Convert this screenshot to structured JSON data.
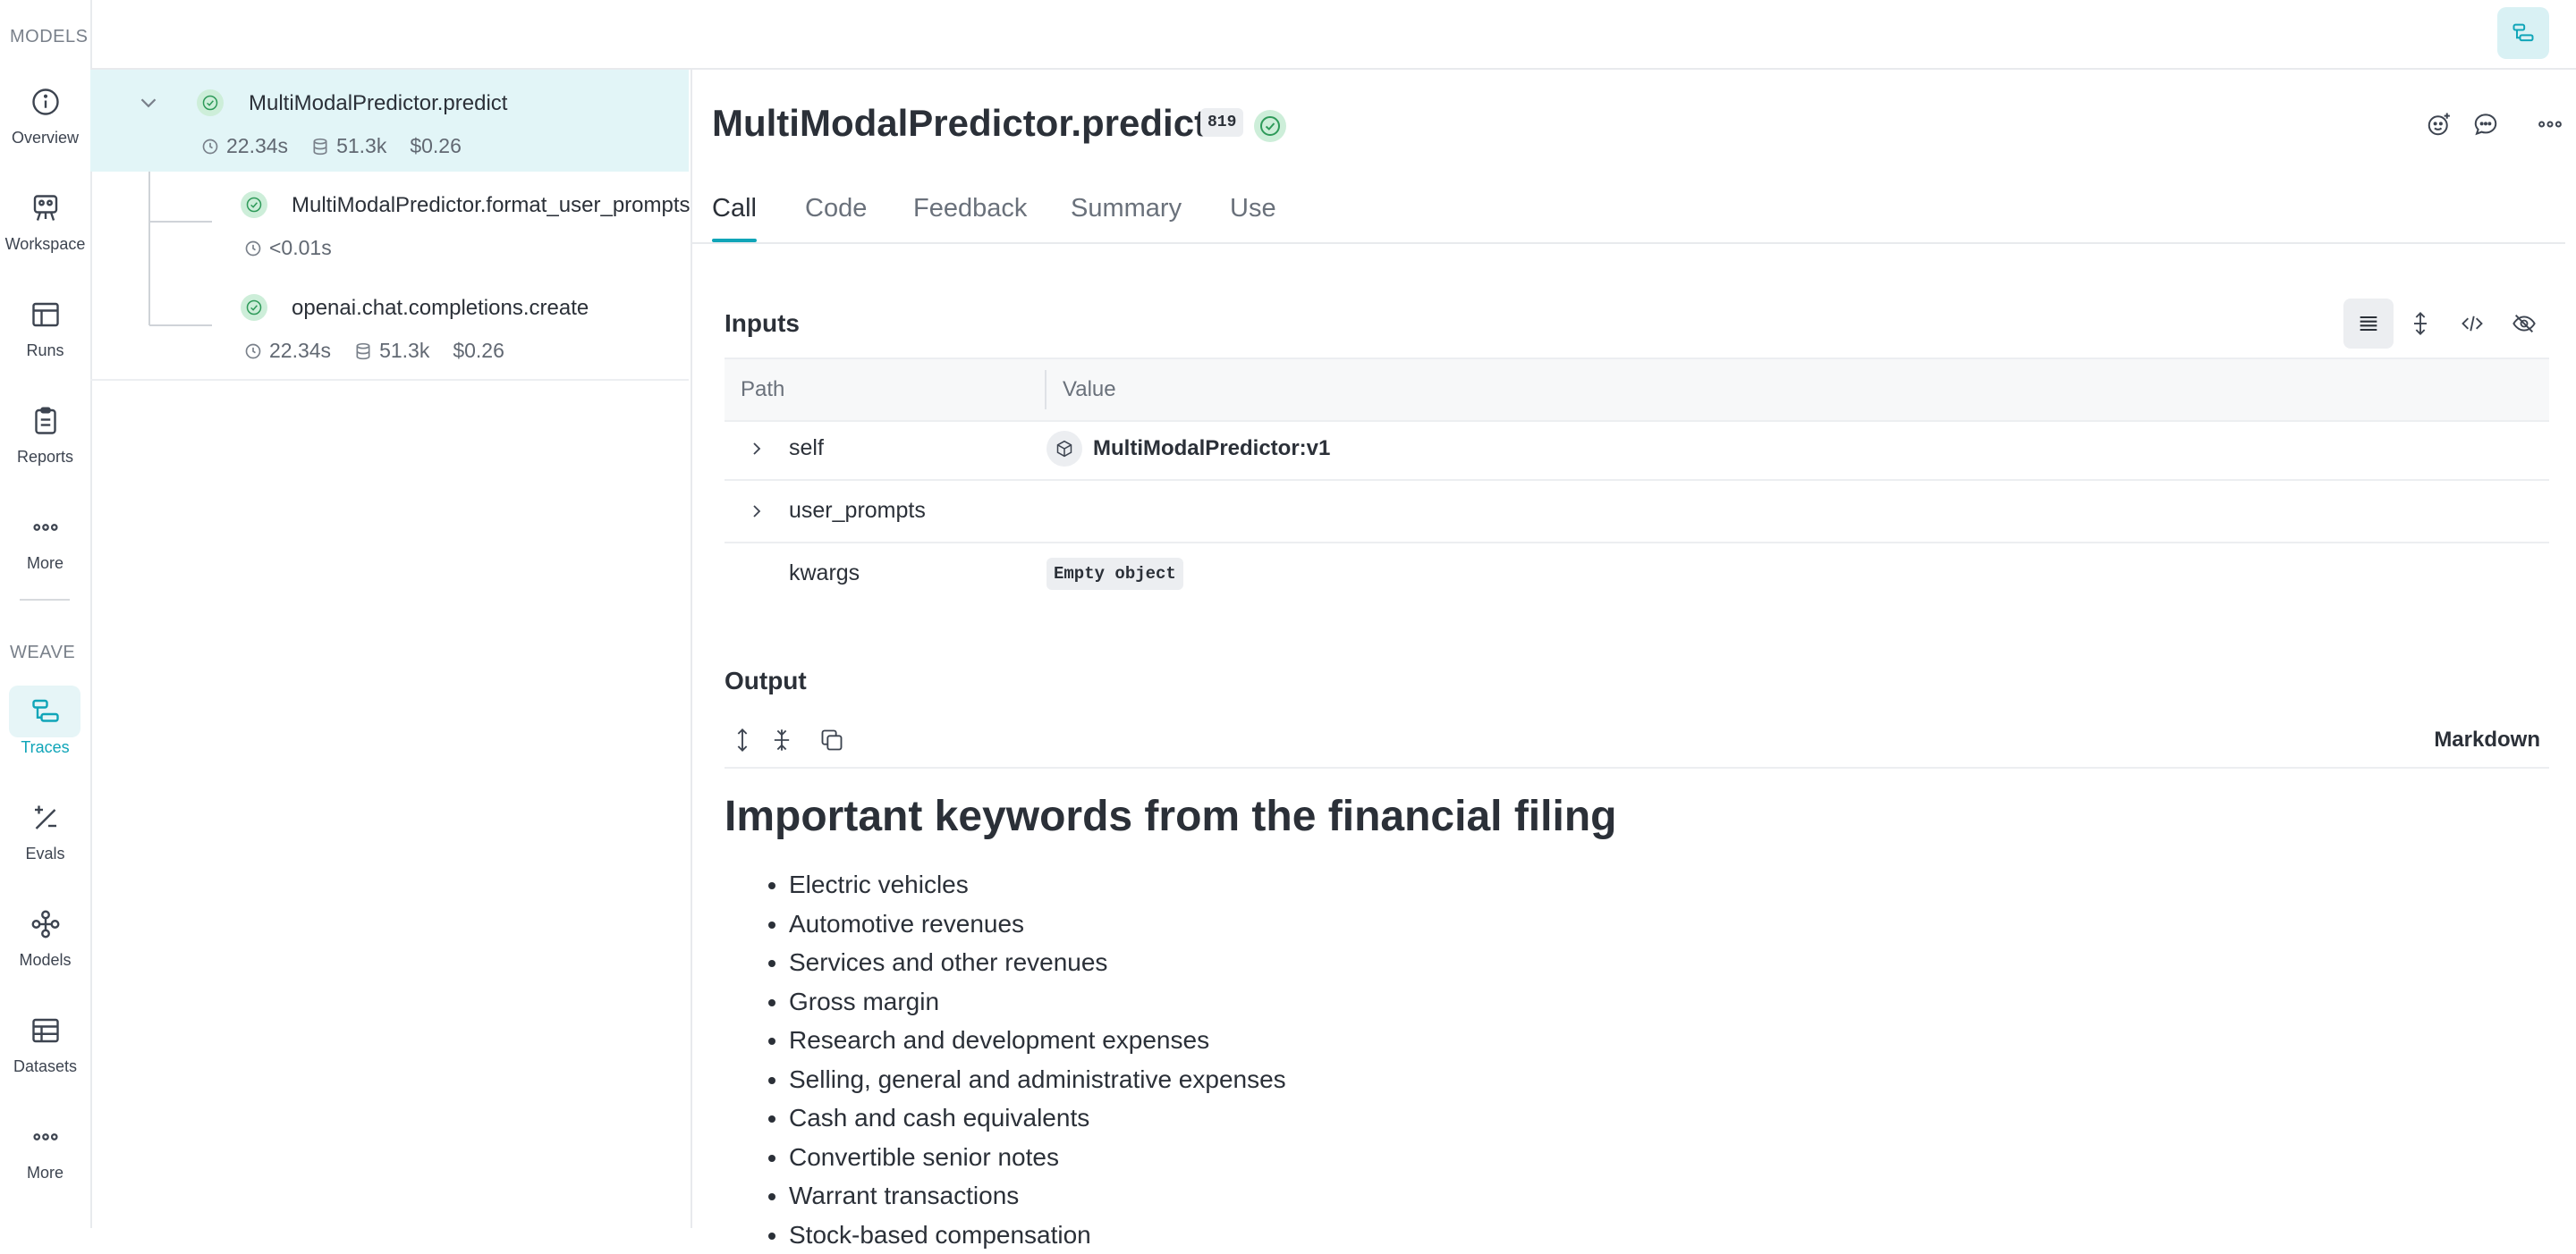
{
  "sidebar": {
    "models_header": "MODELS",
    "weave_header": "WEAVE",
    "models_items": [
      {
        "label": "Overview",
        "icon": "info-icon"
      },
      {
        "label": "Workspace",
        "icon": "workspace-icon"
      },
      {
        "label": "Runs",
        "icon": "table-icon"
      },
      {
        "label": "Reports",
        "icon": "clipboard-icon"
      },
      {
        "label": "More",
        "icon": "dots-icon"
      }
    ],
    "weave_items": [
      {
        "label": "Traces",
        "icon": "traces-icon",
        "active": true
      },
      {
        "label": "Evals",
        "icon": "evals-icon"
      },
      {
        "label": "Models",
        "icon": "model-icon"
      },
      {
        "label": "Datasets",
        "icon": "dataset-icon"
      },
      {
        "label": "More",
        "icon": "dots-icon"
      }
    ]
  },
  "tree": {
    "root": {
      "name": "MultiModalPredictor.predict",
      "latency": "22.34s",
      "tokens": "51.3k",
      "cost": "$0.26"
    },
    "children": [
      {
        "name": "MultiModalPredictor.format_user_prompts",
        "latency": "<0.01s"
      },
      {
        "name": "openai.chat.completions.create",
        "latency": "22.34s",
        "tokens": "51.3k",
        "cost": "$0.26"
      }
    ]
  },
  "call": {
    "title": "MultiModalPredictor.predict",
    "count_badge": "819",
    "status": "success"
  },
  "tabs": [
    "Call",
    "Code",
    "Feedback",
    "Summary",
    "Use"
  ],
  "inputs": {
    "title": "Inputs",
    "columns": {
      "path": "Path",
      "value": "Value"
    },
    "rows": [
      {
        "path": "self",
        "value": "MultiModalPredictor:v1"
      },
      {
        "path": "user_prompts",
        "value": ""
      },
      {
        "path": "kwargs",
        "value": "Empty object"
      }
    ]
  },
  "output": {
    "title": "Output",
    "format_label": "Markdown",
    "heading": "Important keywords from the financial filing",
    "items": [
      "Electric vehicles",
      "Automotive revenues",
      "Services and other revenues",
      "Gross margin",
      "Research and development expenses",
      "Selling, general and administrative expenses",
      "Cash and cash equivalents",
      "Convertible senior notes",
      "Warrant transactions",
      "Stock-based compensation"
    ]
  },
  "colors": {
    "accent": "#10a5b8",
    "success": "#2e9a59",
    "selected_row": "#e2f5f7"
  }
}
